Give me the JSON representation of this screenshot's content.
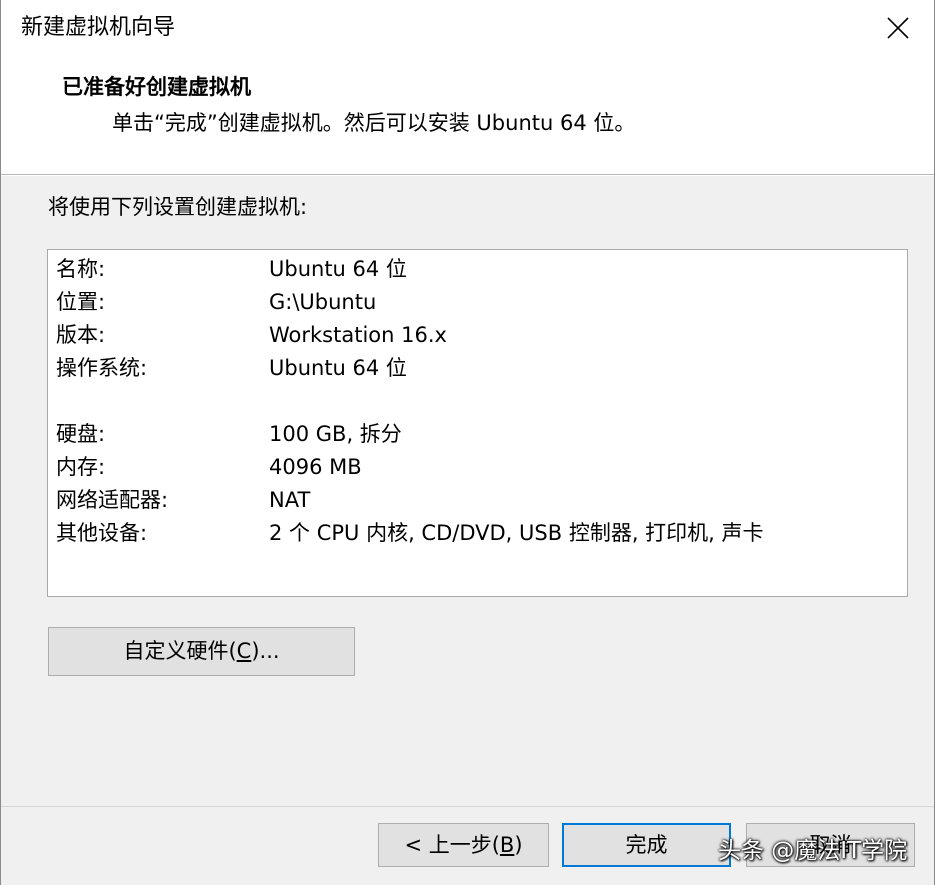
{
  "window": {
    "title": "新建虚拟机向导"
  },
  "header": {
    "title": "已准备好创建虚拟机",
    "subtitle": "单击“完成”创建虚拟机。然后可以安装 Ubuntu 64 位。"
  },
  "body": {
    "intro": "将使用下列设置创建虚拟机:",
    "summary": [
      {
        "label": "名称:",
        "value": "Ubuntu 64 位"
      },
      {
        "label": "位置:",
        "value": "G:\\Ubuntu"
      },
      {
        "label": "版本:",
        "value": "Workstation 16.x"
      },
      {
        "label": "操作系统:",
        "value": "Ubuntu 64 位"
      },
      {
        "label": "硬盘:",
        "value": "100 GB, 拆分"
      },
      {
        "label": "内存:",
        "value": "4096 MB"
      },
      {
        "label": "网络适配器:",
        "value": "NAT"
      },
      {
        "label": "其他设备:",
        "value": "2 个 CPU 内核, CD/DVD, USB 控制器, 打印机, 声卡"
      }
    ],
    "customize_button": {
      "prefix": "自定义硬件(",
      "mnemonic": "C",
      "suffix": ")..."
    }
  },
  "footer": {
    "back_button": {
      "prefix": "< 上一步(",
      "mnemonic": "B",
      "suffix": ")"
    },
    "finish_button": "完成",
    "cancel_button": "取消"
  },
  "watermark": "头条 @魔法IT学院",
  "colors": {
    "focus_border": "#0078d7",
    "body_bg": "#f0f0f0",
    "button_bg": "#e1e1e1"
  },
  "icons": {
    "close": "close-icon"
  }
}
